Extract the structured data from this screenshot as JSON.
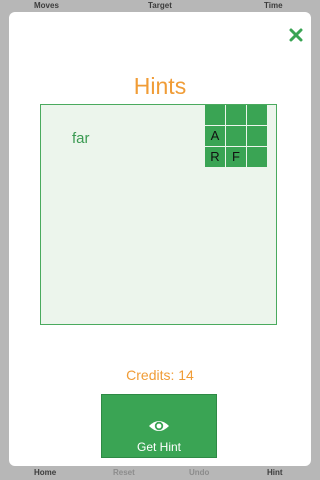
{
  "top_bar": {
    "moves_label": "Moves",
    "target_label": "Target",
    "time_label": "Time"
  },
  "bottom_bar": {
    "home_label": "Home",
    "reset_label": "Reset",
    "undo_label": "Undo",
    "hint_label": "Hint"
  },
  "modal": {
    "close_icon": "close-x",
    "title": "Hints",
    "hint_word": "far",
    "grid": [
      [
        "",
        "",
        ""
      ],
      [
        "A",
        "",
        ""
      ],
      [
        "R",
        "F",
        ""
      ]
    ],
    "credits_text": "Credits: 14",
    "button_icon": "eye",
    "button_label": "Get Hint"
  },
  "colors": {
    "accent_orange": "#f09c36",
    "accent_green": "#3aa454",
    "panel_background": "#ecf5ec",
    "backdrop": "#b7b7b7"
  }
}
